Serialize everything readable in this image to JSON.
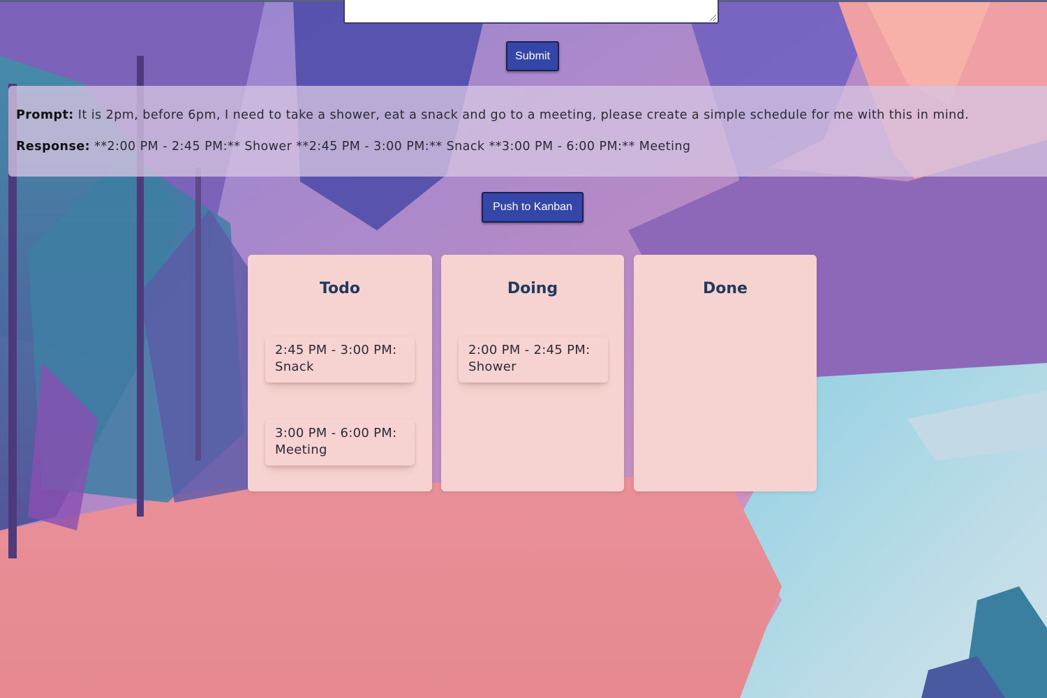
{
  "form": {
    "prompt_value": "",
    "submit_label": "Submit"
  },
  "result": {
    "prompt_label": "Prompt:",
    "prompt_text": " It is 2pm, before 6pm, I need to take a shower, eat a snack and go to a meeting, please create a simple schedule for me with this in mind.",
    "response_label": "Response:",
    "response_text": " **2:00 PM - 2:45 PM:** Shower **2:45 PM - 3:00 PM:** Snack **3:00 PM - 6:00 PM:** Meeting"
  },
  "kanban_button_label": "Push to Kanban",
  "board": {
    "columns": [
      {
        "title": "Todo",
        "cards": [
          "2:45 PM - 3:00 PM: Snack",
          "3:00 PM - 6:00 PM: Meeting"
        ]
      },
      {
        "title": "Doing",
        "cards": [
          "2:00 PM - 2:45 PM: Shower"
        ]
      },
      {
        "title": "Done",
        "cards": []
      }
    ]
  },
  "colors": {
    "button": "#3446a8",
    "column": "#f6d3d0",
    "column_title": "#1f3a5c",
    "panel": "#d6c4e2"
  }
}
